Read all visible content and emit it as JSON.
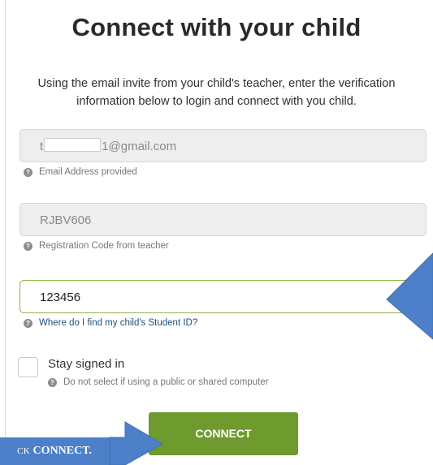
{
  "title": "Connect with your child",
  "subtitle_line1": "Using the email invite from your child's teacher, enter the verification",
  "subtitle_line2": "information below to login and connect with you child.",
  "email": {
    "prefix": "t",
    "suffix": "1@gmail.com",
    "hint": "Email Address provided"
  },
  "registration": {
    "value": "RJBV606",
    "hint": "Registration Code from teacher"
  },
  "student_id": {
    "value": "123456",
    "hint": "Where do I find my child's Student ID?"
  },
  "stay_signed_in": {
    "label": "Stay signed in",
    "hint": "Do not select if using a public or shared computer",
    "checked": false
  },
  "connect_button": "CONNECT",
  "callout": {
    "prefix": "CK",
    "bold": "CONNECT."
  },
  "hint_icon": "question-circle-icon",
  "colors": {
    "button_green": "#6f9a2d",
    "active_border": "#8fb34c",
    "callout_blue": "#4d80c8",
    "link": "#1e4f7a"
  }
}
